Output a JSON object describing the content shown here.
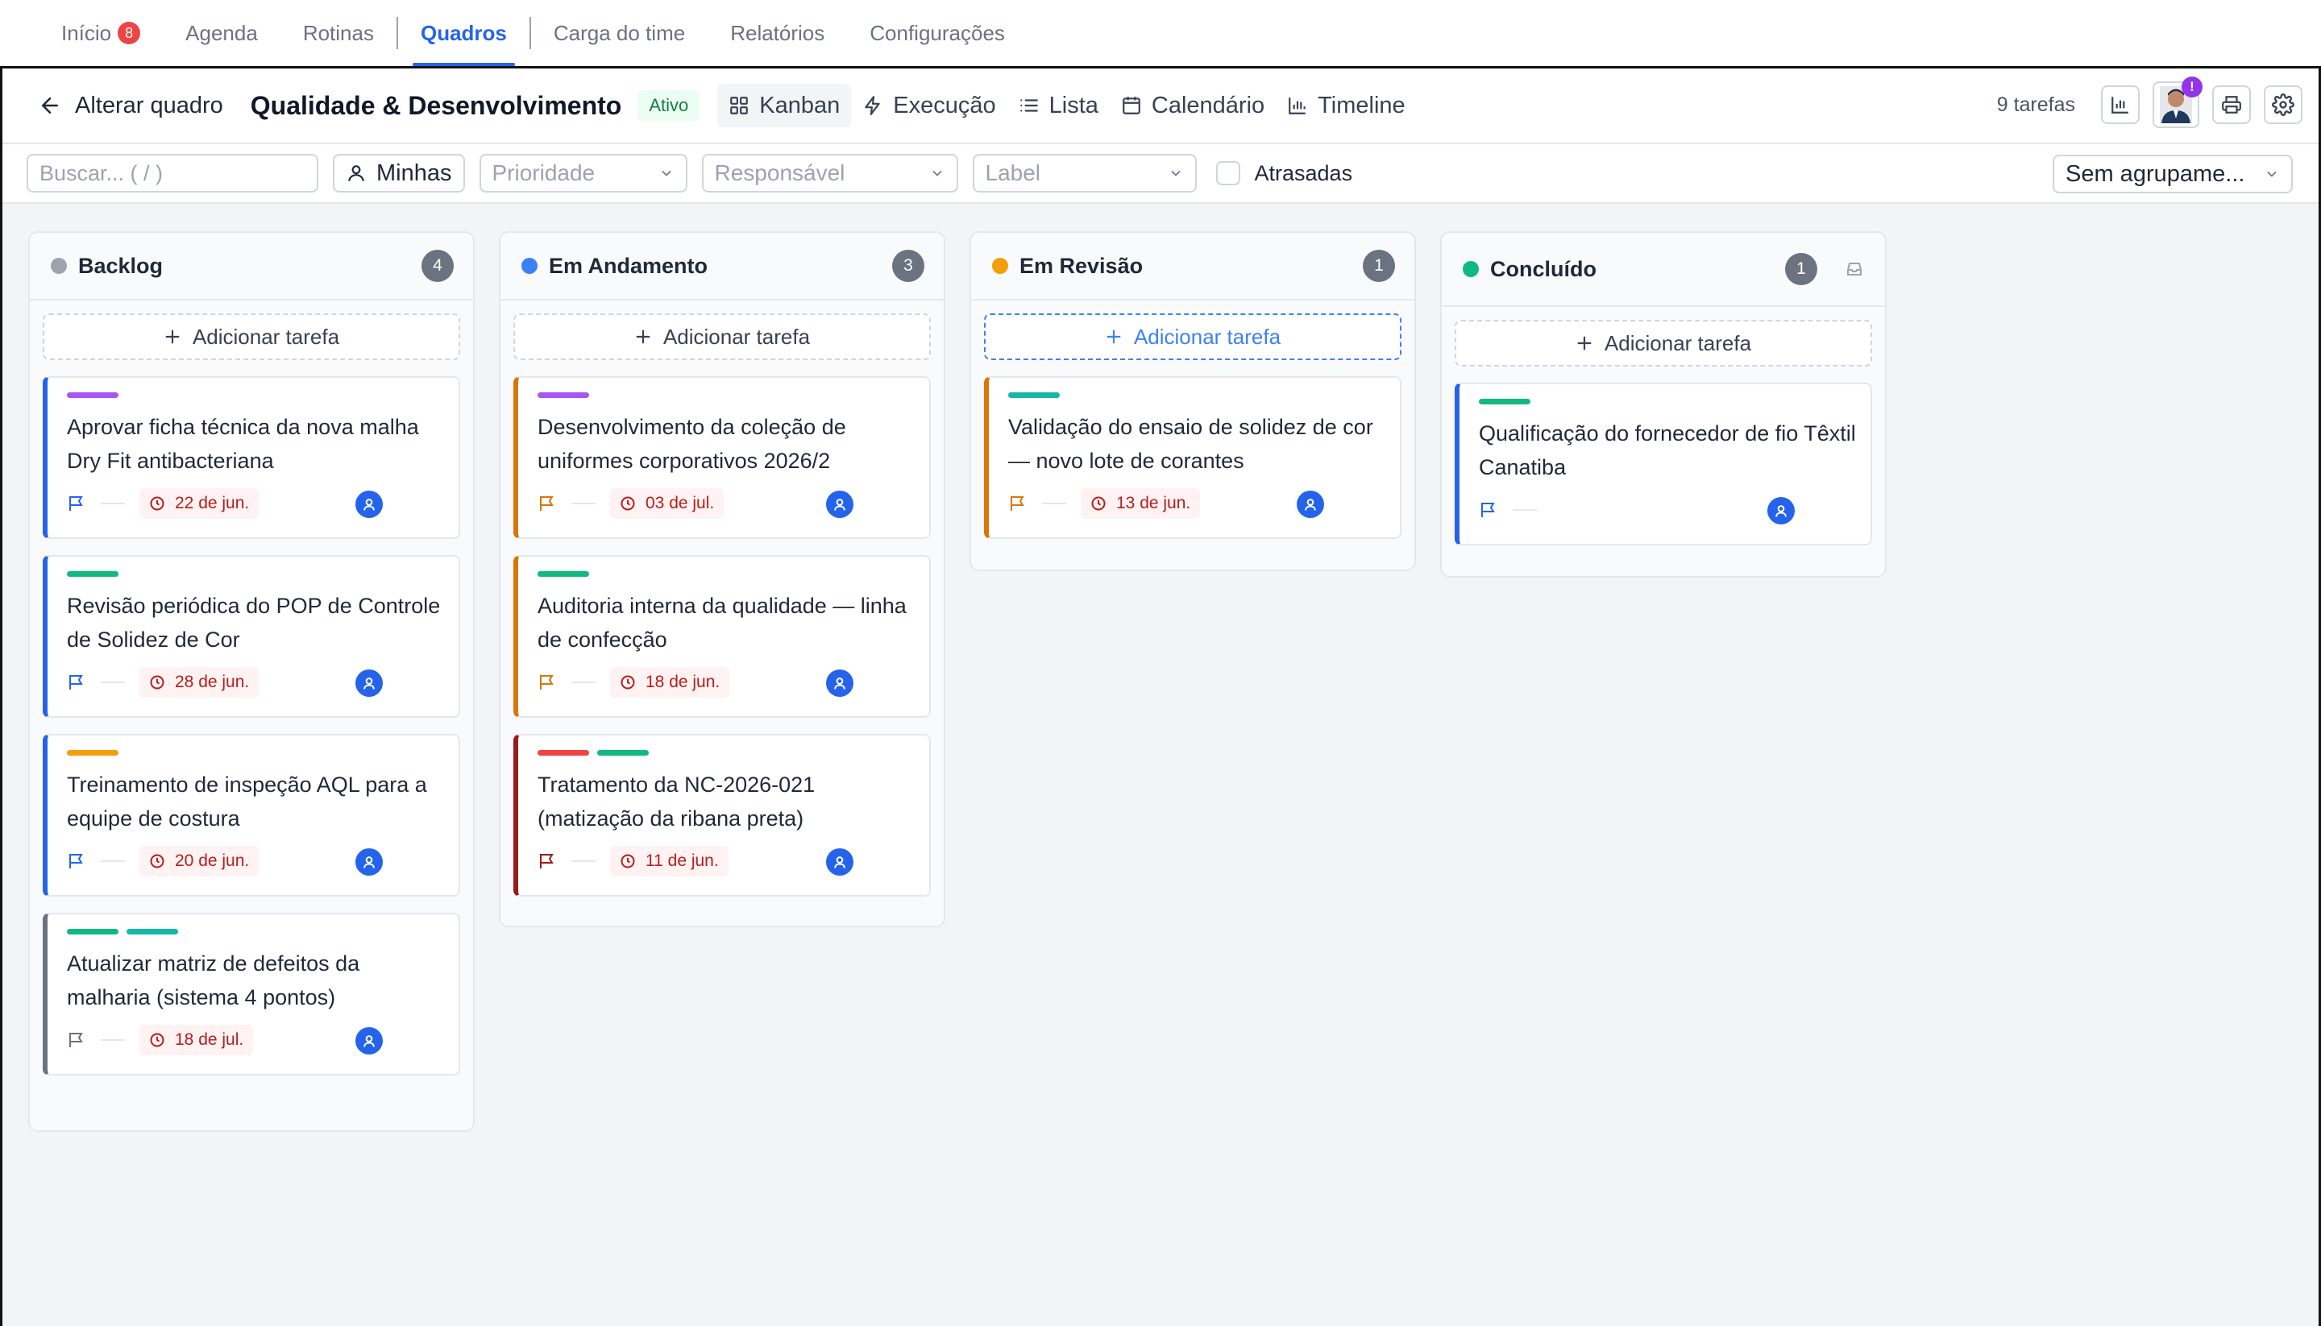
{
  "nav": {
    "items": [
      {
        "label": "Início",
        "badge": "8"
      },
      {
        "label": "Agenda"
      },
      {
        "label": "Rotinas"
      },
      {
        "label": "Quadros"
      },
      {
        "label": "Carga do time"
      },
      {
        "label": "Relatórios"
      },
      {
        "label": "Configurações"
      }
    ],
    "active": "Quadros"
  },
  "header": {
    "back_label": "Alterar quadro",
    "board_title": "Qualidade & Desenvolvimento",
    "status": "Ativo",
    "views": [
      "Kanban",
      "Execução",
      "Lista",
      "Calendário",
      "Timeline"
    ],
    "active_view": "Kanban",
    "task_count": "9 tarefas",
    "alert_badge": "!"
  },
  "filters": {
    "search_placeholder": "Buscar... ( / )",
    "mine_label": "Minhas",
    "priority_placeholder": "Prioridade",
    "assignee_placeholder": "Responsável",
    "label_placeholder": "Label",
    "overdue_label": "Atrasadas",
    "grouping_label": "Sem agrupame..."
  },
  "colors": {
    "accent": "#2563eb",
    "backlog": "#9ca3af",
    "in_progress": "#3b82f6",
    "review": "#f59e0b",
    "done": "#10b981"
  },
  "columns": [
    {
      "title": "Backlog",
      "count": "4",
      "add_label": "Adicionar tarefa",
      "cards": [
        {
          "title": "Aprovar ficha técnica da nova malha Dry Fit antibacteriana",
          "date": "22 de jun."
        },
        {
          "title": "Revisão periódica do POP de Controle de Solidez de Cor",
          "date": "28 de jun."
        },
        {
          "title": "Treinamento de inspeção AQL para a equipe de costura",
          "date": "20 de jun."
        },
        {
          "title": "Atualizar matriz de defeitos da malharia (sistema 4 pontos)",
          "date": "18 de jul."
        }
      ]
    },
    {
      "title": "Em Andamento",
      "count": "3",
      "add_label": "Adicionar tarefa",
      "cards": [
        {
          "title": "Desenvolvimento da coleção de uniformes corporativos 2026/2",
          "date": "03 de jul."
        },
        {
          "title": "Auditoria interna da qualidade — linha de confecção",
          "date": "18 de jun."
        },
        {
          "title": "Tratamento da NC-2026-021 (matização da ribana preta)",
          "date": "11 de jun."
        }
      ]
    },
    {
      "title": "Em Revisão",
      "count": "1",
      "add_label": "Adicionar tarefa",
      "cards": [
        {
          "title": "Validação do ensaio de solidez de cor — novo lote de corantes",
          "date": "13 de jun."
        }
      ]
    },
    {
      "title": "Concluído",
      "count": "1",
      "add_label": "Adicionar tarefa",
      "cards": [
        {
          "title": "Qualificação do fornecedor de fio Têxtil Canatiba",
          "date": ""
        }
      ]
    }
  ]
}
